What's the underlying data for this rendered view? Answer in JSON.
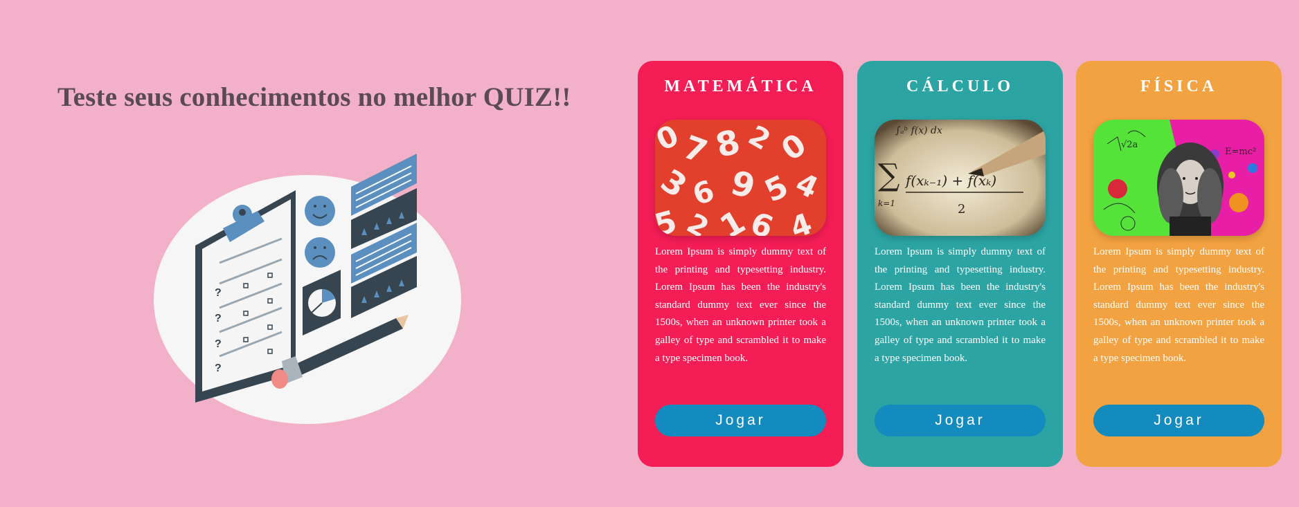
{
  "hero": {
    "title": "Teste seus conhecimentos no melhor QUIZ!!"
  },
  "colors": {
    "background": "#f3b1c9",
    "button": "#138bbf",
    "matematica": "#f41d56",
    "calculo": "#2ca4a3",
    "fisica": "#f3a241"
  },
  "cards": [
    {
      "title": "MATEMÁTICA",
      "image_icon": "numbers-image",
      "text": "Lorem Ipsum is simply dummy text of the printing and typesetting industry. Lorem Ipsum has been the industry's standard dummy text ever since the 1500s, when an unknown printer took a galley of type and scrambled it to make a type specimen book.",
      "button_label": "Jogar"
    },
    {
      "title": "CÁLCULO",
      "image_icon": "formula-image",
      "text": "Lorem Ipsum is simply dummy text of the printing and typesetting industry. Lorem Ipsum has been the industry's standard dummy text ever since the 1500s, when an unknown printer took a galley of type and scrambled it to make a type specimen book.",
      "button_label": "Jogar"
    },
    {
      "title": "FÍSICA",
      "image_icon": "newton-image",
      "text": "Lorem Ipsum is simply dummy text of the printing and typesetting industry. Lorem Ipsum has been the industry's standard dummy text ever since the 1500s, when an unknown printer took a galley of type and scrambled it to make a type specimen book.",
      "button_label": "Jogar"
    }
  ]
}
